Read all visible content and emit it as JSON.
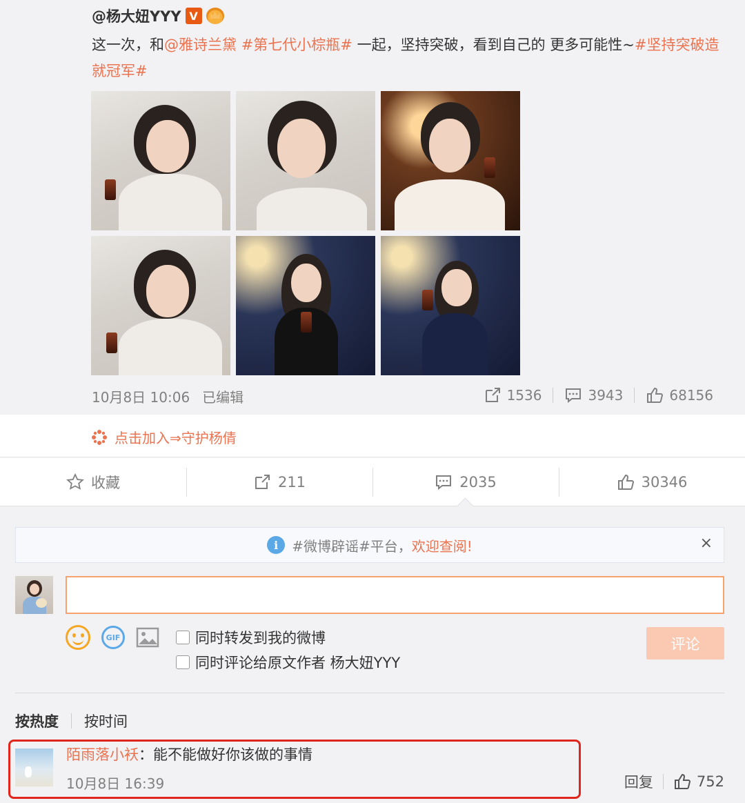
{
  "post": {
    "author": "@杨大妞YYY",
    "verified_badge": "V",
    "text_segments": [
      {
        "text": "这一次，和",
        "link": false
      },
      {
        "text": "@雅诗兰黛",
        "link": true
      },
      {
        "text": " ",
        "link": false
      },
      {
        "text": "#第七代小棕瓶#",
        "link": true
      },
      {
        "text": " 一起，坚持突破，看到自己的 更多可能性~",
        "link": false
      },
      {
        "text": "#坚持突破造就冠军#",
        "link": true
      }
    ],
    "photo_count": 6,
    "date": "10月8日 10:06",
    "edited": "已编辑",
    "reposts": "1536",
    "comments": "3943",
    "likes": "68156"
  },
  "join": {
    "label": "点击加入⇒守护杨倩"
  },
  "toolbar": {
    "favorite": "收藏",
    "forward": "211",
    "comment": "2035",
    "like": "30346"
  },
  "notice": {
    "text": "#微博辟谣#平台，",
    "highlight": "欢迎查阅!",
    "close": "×"
  },
  "compose": {
    "placeholder": "",
    "repost_option": "同时转发到我的微博",
    "comment_option": "同时评论给原文作者 杨大妞YYY",
    "submit": "评论",
    "gif_label": "GIF"
  },
  "sort": {
    "hot": "按热度",
    "time": "按时间"
  },
  "comment": {
    "user": "陌雨落小袄",
    "colon": "：",
    "text": "能不能做好你该做的事情",
    "time": "10月8日 16:39",
    "reply": "回复",
    "likes": "752"
  },
  "colors": {
    "accent": "#eb7350",
    "highlight_border": "#e0261c",
    "info_blue": "#5aa8e6",
    "emoji_yellow": "#f5a623"
  }
}
